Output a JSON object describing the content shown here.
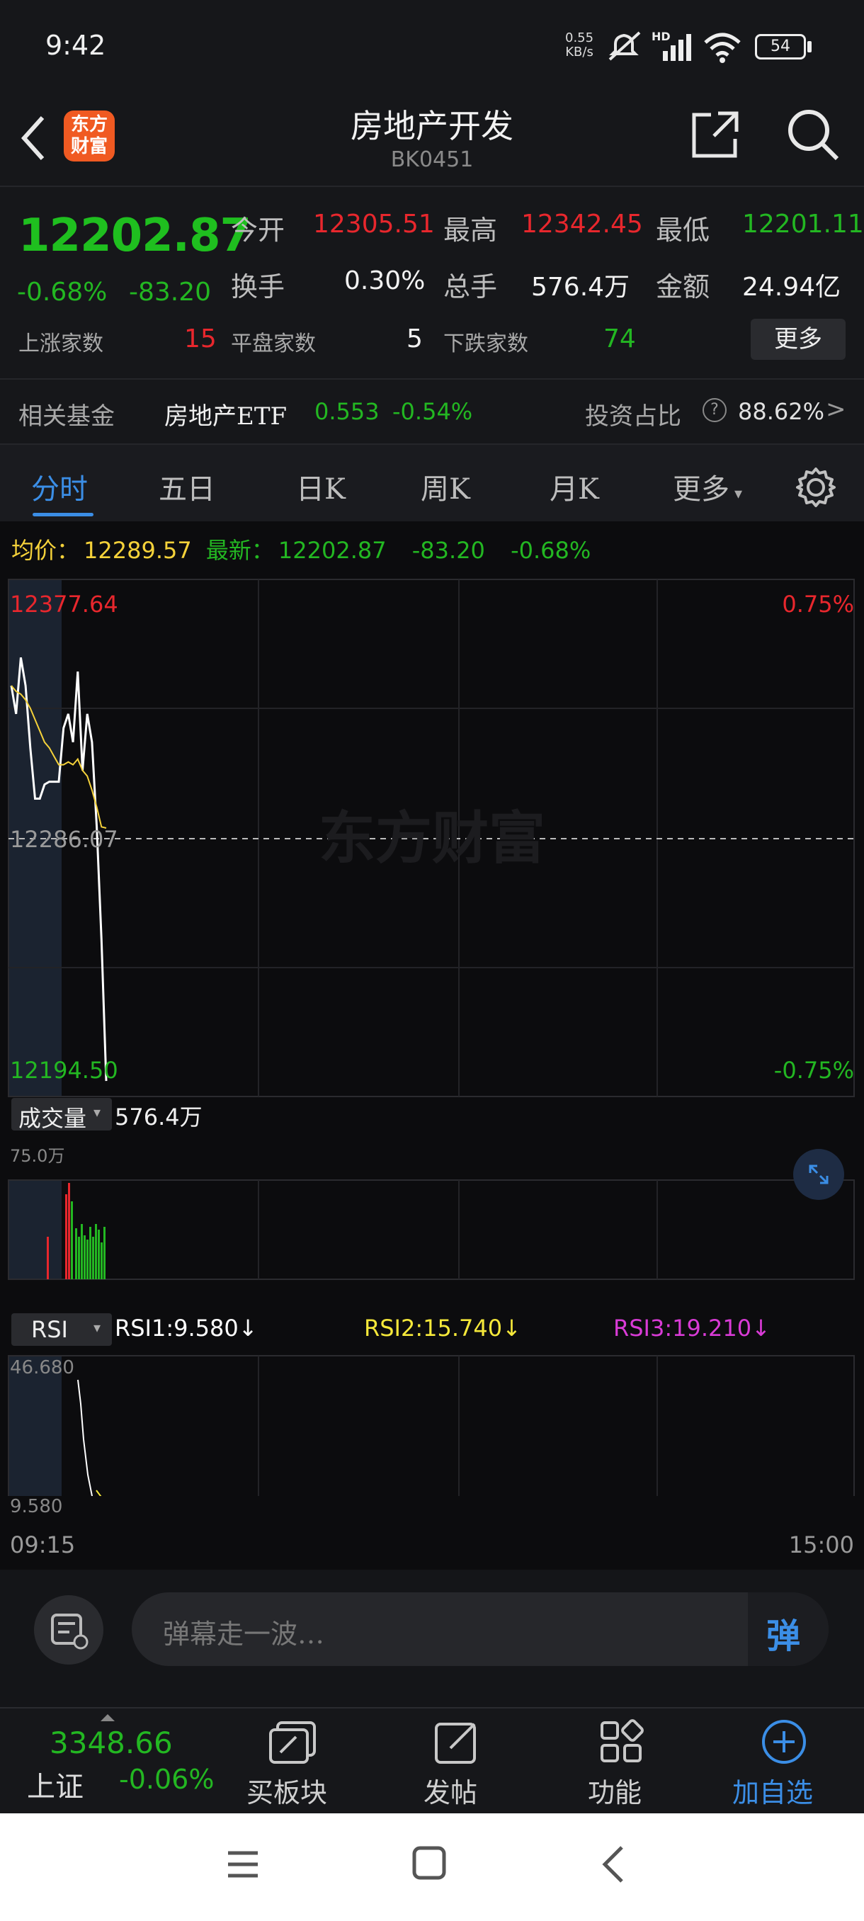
{
  "status_bar": {
    "time": "9:42",
    "net_speed_value": "0.55",
    "net_speed_unit": "KB/s",
    "network_type": "HD",
    "battery": "54"
  },
  "header": {
    "logo_text": "东方财富",
    "title": "房地产开发",
    "code": "BK0451",
    "icons": [
      "back-arrow-icon",
      "share-icon",
      "search-icon"
    ]
  },
  "quote": {
    "price": "12202.87",
    "change_pct": "-0.68%",
    "change": "-83.20",
    "open_label": "今开",
    "open": "12305.51",
    "high_label": "最高",
    "high": "12342.45",
    "low_label": "最低",
    "low": "12201.11",
    "turnover_label": "换手",
    "turnover": "0.30%",
    "volume_label": "总手",
    "volume": "576.4万",
    "amount_label": "金额",
    "amount": "24.94亿",
    "up_label": "上涨家数",
    "up_count": "15",
    "flat_label": "平盘家数",
    "flat_count": "5",
    "down_label": "下跌家数",
    "down_count": "74",
    "more_button": "更多"
  },
  "fund": {
    "label": "相关基金",
    "name": "房地产ETF",
    "price": "0.553",
    "change": "-0.54%",
    "ratio_label": "投资占比",
    "ratio": "88.62%",
    "chevron": ">"
  },
  "tabs": {
    "items": [
      "分时",
      "五日",
      "日K",
      "周K",
      "月K",
      "更多"
    ],
    "active": 0
  },
  "chart": {
    "avg_label": "均价：",
    "avg_price": "12289.57",
    "latest_label": "最新：",
    "latest_price": "12202.87",
    "latest_change": "-83.20",
    "latest_pct": "-0.68%",
    "top_price": "12377.64",
    "top_pct": "0.75%",
    "mid_price": "12286.07",
    "bottom_price": "12194.50",
    "bottom_pct": "-0.75%",
    "watermark": "东方财富",
    "volume_selector": "成交量",
    "volume_total": "576.4万",
    "volume_max": "75.0万",
    "rsi_selector": "RSI",
    "rsi1": "RSI1:9.580↓",
    "rsi2": "RSI2:15.740↓",
    "rsi3": "RSI3:19.210↓",
    "rsi_top": "46.680",
    "rsi_bottom": "9.580",
    "time_start": "09:15",
    "time_end": "15:00",
    "colors": {
      "price_line": "#ffffff",
      "avg_line": "#f5d23a",
      "up": "#e8272d",
      "down": "#23b722",
      "rsi1": "#ffffff",
      "rsi2": "#f5e83a",
      "rsi3": "#d93bd6"
    }
  },
  "chart_data": {
    "type": "line",
    "title": "",
    "xlabel": "",
    "ylabel": "",
    "ylim": [
      12194.5,
      12377.64
    ],
    "x_range": [
      "09:15",
      "15:00"
    ],
    "series": [
      {
        "name": "",
        "values": [
          12340,
          12330,
          12350,
          12340,
          12318,
          12300,
          12300,
          12305,
          12306,
          12306,
          12306,
          12325,
          12330,
          12320,
          12345,
          12310,
          12330,
          12320,
          12290,
          12250,
          12200
        ]
      },
      {
        "name": "均价",
        "values": [
          12340,
          12338,
          12337,
          12335,
          12332,
          12328,
          12324,
          12320,
          12318,
          12315,
          12312,
          12312,
          12313,
          12312,
          12314,
          12310,
          12308,
          12303,
          12297,
          12290,
          12289.57
        ]
      }
    ]
  },
  "danmu": {
    "placeholder": "弹幕走一波…",
    "send_label": "弹"
  },
  "bottom_nav": {
    "index_value": "3348.66",
    "index_name": "上证",
    "index_change": "-0.06%",
    "items": [
      "买板块",
      "发帖",
      "功能",
      "加自选"
    ]
  }
}
